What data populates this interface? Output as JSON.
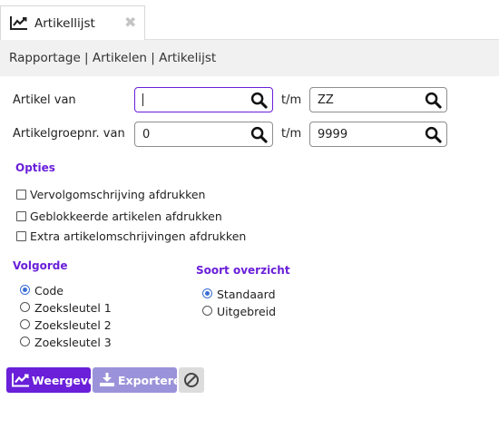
{
  "tab": {
    "label": "Artikellijst",
    "close": "✖"
  },
  "breadcrumb": "Rapportage | Artikelen | Artikelijst",
  "form": {
    "article_from_label": "Artikel van",
    "article_from_value": "",
    "to_label_1": "t/m",
    "article_to_value": "ZZ",
    "group_from_label": "Artikelgroepnr. van",
    "group_from_value": "0",
    "to_label_2": "t/m",
    "group_to_value": "9999"
  },
  "options": {
    "title": "Opties",
    "items": [
      {
        "label": "Vervolgomschrijving afdrukken",
        "checked": false
      },
      {
        "label": "Geblokkeerde artikelen afdrukken",
        "checked": false
      },
      {
        "label": "Extra artikelomschrijvingen afdrukken",
        "checked": false
      }
    ]
  },
  "order": {
    "title": "Volgorde",
    "items": [
      {
        "label": "Code",
        "selected": true
      },
      {
        "label": "Zoeksleutel 1",
        "selected": false
      },
      {
        "label": "Zoeksleutel 2",
        "selected": false
      },
      {
        "label": "Zoeksleutel 3",
        "selected": false
      }
    ]
  },
  "overview": {
    "title": "Soort overzicht",
    "items": [
      {
        "label": "Standaard",
        "selected": true
      },
      {
        "label": "Uitgebreid",
        "selected": false
      }
    ]
  },
  "buttons": {
    "show": "Weergeven",
    "export": "Exporteren",
    "cancel_icon": "cancel-icon"
  },
  "colors": {
    "accent": "#6a1fd9",
    "export": "#9b93d9",
    "radio": "#3b6fd3"
  }
}
